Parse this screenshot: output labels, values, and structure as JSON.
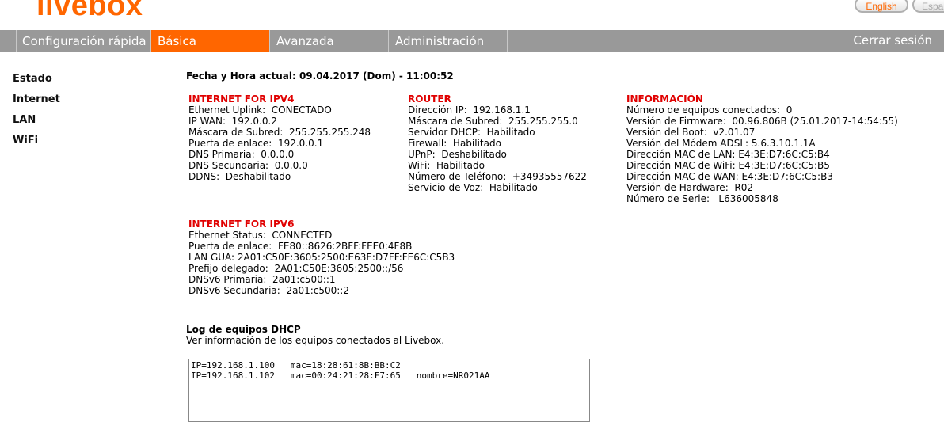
{
  "header": {
    "logo_text": "livebox",
    "lang_english": "English",
    "lang_spanish": "Espa"
  },
  "nav": {
    "items": [
      {
        "label": "Configuración rápida",
        "active": false
      },
      {
        "label": "Básica",
        "active": true
      },
      {
        "label": "Avanzada",
        "active": false
      },
      {
        "label": "Administración",
        "active": false
      }
    ],
    "logout": "Cerrar sesión",
    "colors": {
      "bar": "#999999",
      "active": "#ff6600"
    }
  },
  "sidebar": {
    "items": [
      {
        "label": "Estado"
      },
      {
        "label": "Internet"
      },
      {
        "label": "LAN"
      },
      {
        "label": "WiFi"
      }
    ]
  },
  "datetime": "Fecha y Hora actual: 09.04.2017 (Dom) - 11:00:52",
  "ipv4": {
    "title": "INTERNET FOR IPV4",
    "rows": [
      "Ethernet Uplink:  CONECTADO",
      "IP WAN:  192.0.0.2",
      "Máscara de Subred:  255.255.255.248",
      "Puerta de enlace:  192.0.0.1",
      "DNS Primaria:  0.0.0.0",
      "DNS Secundaria:  0.0.0.0",
      "DDNS:  Deshabilitado"
    ]
  },
  "router": {
    "title": "ROUTER",
    "rows": [
      "Dirección IP:  192.168.1.1",
      "Máscara de Subred:  255.255.255.0",
      "Servidor DHCP:  Habilitado",
      "Firewall:  Habilitado",
      "UPnP:  Deshabilitado",
      "WiFi:  Habilitado",
      "Número de Teléfono:  +34935557622",
      "Servicio de Voz:  Habilitado"
    ]
  },
  "info": {
    "title": "INFORMACIÓN",
    "rows": [
      "Número de equipos conectados:  0",
      "Versión de Firmware:  00.96.806B (25.01.2017-14:54:55)",
      "Versión del Boot:  v2.01.07",
      "Versión del Módem ADSL: 5.6.3.10.1.1A",
      "Dirección MAC de LAN: E4:3E:D7:6C:C5:B4",
      "Dirección MAC de WiFi: E4:3E:D7:6C:C5:B5",
      "Dirección MAC de WAN: E4:3E:D7:6C:C5:B3",
      "Versión de Hardware:  R02",
      "Número de Serie:   L636005848"
    ]
  },
  "ipv6": {
    "title": "INTERNET FOR IPV6",
    "rows": [
      "Ethernet Status:  CONNECTED",
      "Puerta de enlace:  FE80::8626:2BFF:FEE0:4F8B",
      "LAN GUA: 2A01:C50E:3605:2500:E63E:D7FF:FE6C:C5B3",
      "Prefijo delegado:  2A01:C50E:3605:2500::/56",
      "DNSv6 Primaria:  2a01:c500::1",
      "DNSv6 Secundaria:  2a01:c500::2"
    ]
  },
  "dhcp_log": {
    "title": "Log de equipos DHCP",
    "description": "Ver información de los equipos conectados al Livebox.",
    "lines": [
      "IP=192.168.1.100   mac=18:28:61:8B:BB:C2",
      "IP=192.168.1.102   mac=00:24:21:28:F7:65   nombre=NR021AA"
    ]
  }
}
